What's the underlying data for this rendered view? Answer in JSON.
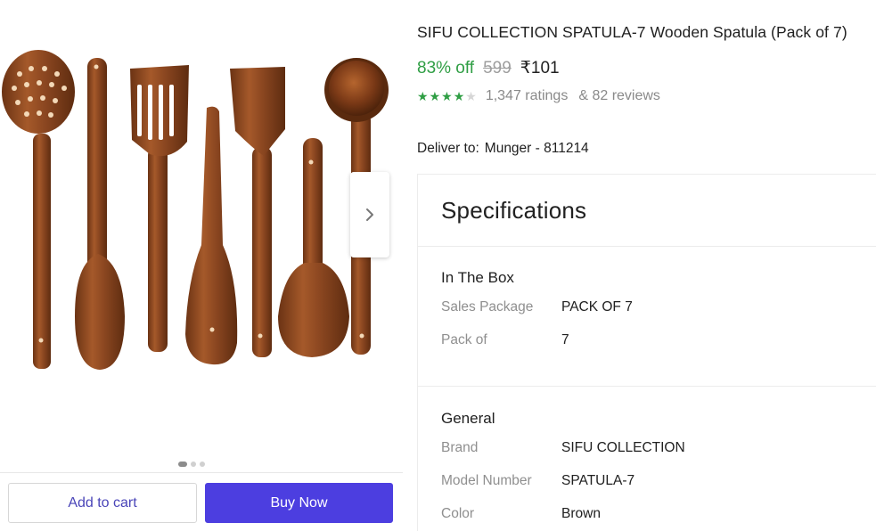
{
  "product": {
    "title": "SIFU COLLECTION SPATULA-7 Wooden Spatula (Pack of 7)",
    "discount": "83% off",
    "mrp": "599",
    "price": "₹101",
    "rating_stars": 4,
    "ratings_text": "1,347 ratings",
    "reviews_text": "& 82 reviews"
  },
  "gallery": {
    "image_name": "wooden-spatula-set-image",
    "slide_count": 3,
    "active_slide": 1,
    "next_icon": "chevron-right-icon"
  },
  "delivery": {
    "label": "Deliver to:",
    "location": "Munger - 811214"
  },
  "actions": {
    "add_to_cart": "Add to cart",
    "buy_now": "Buy Now"
  },
  "specifications": {
    "heading": "Specifications",
    "groups": [
      {
        "title": "In The Box",
        "rows": [
          {
            "key": "Sales Package",
            "value": "PACK OF 7"
          },
          {
            "key": "Pack of",
            "value": "7"
          }
        ]
      },
      {
        "title": "General",
        "rows": [
          {
            "key": "Brand",
            "value": "SIFU COLLECTION"
          },
          {
            "key": "Model Number",
            "value": "SPATULA-7"
          },
          {
            "key": "Color",
            "value": "Brown"
          }
        ]
      }
    ]
  },
  "colors": {
    "discount_green": "#2f9e44",
    "buy_button": "#4c3ee0",
    "cart_text": "#4a45b8",
    "wood": "#8a4a22"
  }
}
